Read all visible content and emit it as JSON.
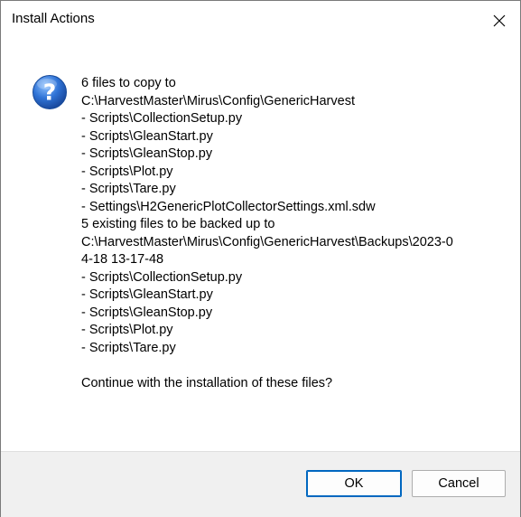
{
  "window": {
    "title": "Install Actions"
  },
  "icons": {
    "close": "close-icon",
    "question": "question-mark-icon"
  },
  "message": {
    "copy_header": "6 files to copy to",
    "copy_dest": "C:\\HarvestMaster\\Mirus\\Config\\GenericHarvest",
    "copy_files": [
      "- Scripts\\CollectionSetup.py",
      "- Scripts\\GleanStart.py",
      "- Scripts\\GleanStop.py",
      "- Scripts\\Plot.py",
      "- Scripts\\Tare.py",
      "- Settings\\H2GenericPlotCollectorSettings.xml.sdw"
    ],
    "backup_header": "5 existing files to be backed up to",
    "backup_dest_line1": "C:\\HarvestMaster\\Mirus\\Config\\GenericHarvest\\Backups\\2023-0",
    "backup_dest_line2": "4-18 13-17-48",
    "backup_files": [
      "- Scripts\\CollectionSetup.py",
      "- Scripts\\GleanStart.py",
      "- Scripts\\GleanStop.py",
      "- Scripts\\Plot.py",
      "- Scripts\\Tare.py"
    ],
    "question": "Continue with the installation of these files?"
  },
  "buttons": {
    "ok": "OK",
    "cancel": "Cancel"
  },
  "colors": {
    "accent": "#0067c0",
    "icon_blue": "#1f5fbf",
    "footer_bg": "#f0f0f0"
  }
}
